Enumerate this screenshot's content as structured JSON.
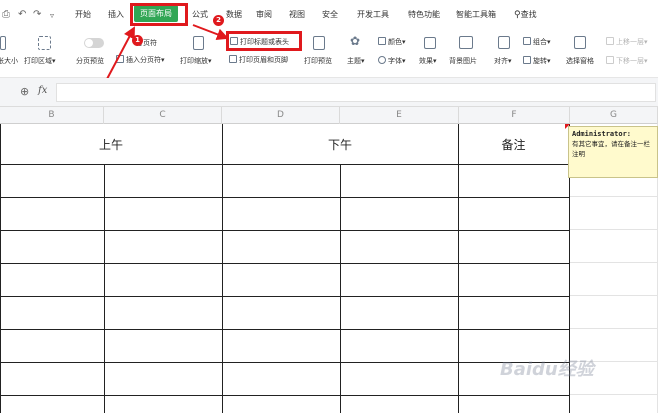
{
  "menu": {
    "tabs": [
      "开始",
      "插入",
      "页面布局",
      "公式",
      "数据",
      "审阅",
      "视图",
      "安全",
      "开发工具",
      "特色功能",
      "智能工具箱"
    ],
    "active": "页面布局",
    "search": "查找"
  },
  "ribbon": {
    "print_area_label": "打印区域",
    "size_label": "纸张大小",
    "page_break_preview": "分页预览",
    "insert_page_break": "插入分页符",
    "page_break_text": "分页符",
    "print_scale": "打印缩放",
    "print_titles": "打印标题或表头",
    "print_header_footer": "打印页眉和页脚",
    "print_preview": "打印预览",
    "theme": "主题",
    "color": "颜色",
    "font": "字体",
    "effects": "效果",
    "background": "背景图片",
    "align": "对齐",
    "group": "组合",
    "rotate": "旋转",
    "selection_pane": "选择窗格",
    "bring_forward": "上移一层",
    "send_backward": "下移一层"
  },
  "annotations": {
    "step1": "1",
    "step2": "2"
  },
  "formula_bar": {
    "cell_ref_icon": "zoom-icon",
    "fx": "fx"
  },
  "columns": [
    "B",
    "C",
    "D",
    "E",
    "F",
    "G"
  ],
  "table": {
    "morning": "上午",
    "afternoon": "下午",
    "notes": "备注"
  },
  "comment": {
    "author": "Administrator:",
    "text": "有其它事宜，请在备注一栏注明"
  },
  "watermark": "Baidu经验",
  "colors": {
    "accent_green": "#31a655",
    "annotation_red": "#e0191d"
  }
}
